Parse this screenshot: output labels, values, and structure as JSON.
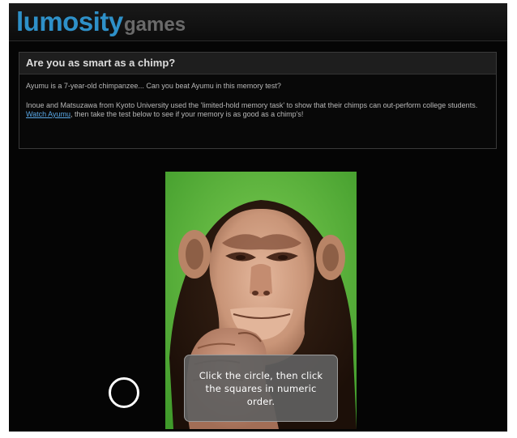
{
  "header": {
    "brand": "lumosity",
    "section": "games"
  },
  "intro": {
    "title": "Are you as smart as a chimp?",
    "line1": "Ayumu is a 7-year-old chimpanzee... Can you beat Ayumu in this memory test?",
    "para_before_link": "Inoue and Matsuzawa from Kyoto University used the 'limited-hold memory task' to show that their chimps can out-perform college students. ",
    "link_text": "Watch Ayumu",
    "para_after_link": ", then take the test below to see if your memory is as good as a chimp's!"
  },
  "game": {
    "instructions": "Click the circle, then click the squares in numeric order.",
    "image_subject": "chimpanzee-photo",
    "start_control": "start-circle"
  },
  "colors": {
    "brand_blue": "#2e90c8",
    "background": "#050505",
    "panel_bg": "#1e1e1e",
    "link": "#5aa8e6",
    "photo_background": "#55b03a",
    "overlay": "#5f5f5f"
  }
}
